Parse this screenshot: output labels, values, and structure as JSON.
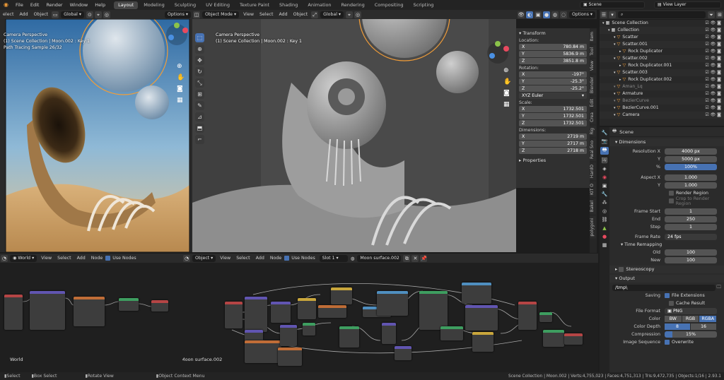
{
  "topbar": {
    "menus": [
      "File",
      "Edit",
      "Render",
      "Window",
      "Help"
    ],
    "workspaces": [
      "Layout",
      "Modeling",
      "Sculpting",
      "UV Editing",
      "Texture Paint",
      "Shading",
      "Animation",
      "Rendering",
      "Compositing",
      "Scripting"
    ],
    "active_workspace": "Layout",
    "scene": "Scene",
    "view_layer": "View Layer"
  },
  "viewport_left": {
    "header": {
      "menus": [
        "elect",
        "Add",
        "Object"
      ],
      "transform": "Global",
      "options": "Options"
    },
    "overlay": [
      "Camera Perspective",
      "(1) Scene Collection | Moon.002 : Key 1",
      "Path Tracing Sample 26/32"
    ]
  },
  "viewport_right": {
    "header": {
      "mode": "Object Mode",
      "menus": [
        "View",
        "Select",
        "Add",
        "Object"
      ],
      "transform": "Global",
      "options": "Options"
    },
    "overlay": [
      "Camera Perspective",
      "(1) Scene Collection | Moon.002 : Key 1"
    ]
  },
  "npanel": {
    "title": "Transform",
    "location_label": "Location:",
    "location": [
      {
        "axis": "X",
        "value": "780.84 m"
      },
      {
        "axis": "Y",
        "value": "5836.9 m"
      },
      {
        "axis": "Z",
        "value": "3851.8 m"
      }
    ],
    "rotation_label": "Rotation:",
    "rotation": [
      {
        "axis": "X",
        "value": "-197°"
      },
      {
        "axis": "Y",
        "value": "-25.3°"
      },
      {
        "axis": "Z",
        "value": "-25.2°"
      }
    ],
    "rotation_mode": "XYZ Euler",
    "scale_label": "Scale:",
    "scale": [
      {
        "axis": "X",
        "value": "1732.501"
      },
      {
        "axis": "Y",
        "value": "1732.501"
      },
      {
        "axis": "Z",
        "value": "1732.501"
      }
    ],
    "dimensions_label": "Dimensions:",
    "dimensions": [
      {
        "axis": "X",
        "value": "2719 m"
      },
      {
        "axis": "Y",
        "value": "2717 m"
      },
      {
        "axis": "Z",
        "value": "2718 m"
      }
    ],
    "properties": "Properties",
    "tabs": [
      "Item",
      "Tool",
      "View",
      "Blender",
      "Edit",
      "Crea",
      "Rig",
      "Real Sno",
      "HardO",
      "KIT O",
      "Bakel",
      "polygoni"
    ]
  },
  "outliner": {
    "rows": [
      {
        "label": "Scene Collection",
        "indent": 0,
        "dim": false
      },
      {
        "label": "Collection",
        "indent": 1,
        "dim": false
      },
      {
        "label": "Scatter",
        "indent": 2,
        "dim": false
      },
      {
        "label": "Scatter.001",
        "indent": 2,
        "dim": false
      },
      {
        "label": "Rock Duplicator",
        "indent": 3,
        "dim": false
      },
      {
        "label": "Scatter.002",
        "indent": 2,
        "dim": false
      },
      {
        "label": "Rock Duplicator.001",
        "indent": 3,
        "dim": false
      },
      {
        "label": "Scatter.003",
        "indent": 2,
        "dim": false
      },
      {
        "label": "Rock Duplicator.002",
        "indent": 3,
        "dim": false
      },
      {
        "label": "Aman_Lq",
        "indent": 2,
        "dim": true
      },
      {
        "label": "Armature",
        "indent": 2,
        "dim": false
      },
      {
        "label": "BezierCurve",
        "indent": 2,
        "dim": true
      },
      {
        "label": "BezierCurve.001",
        "indent": 2,
        "dim": false
      },
      {
        "label": "Camera",
        "indent": 2,
        "dim": false
      }
    ]
  },
  "properties": {
    "scene": "Scene",
    "dimensions_title": "Dimensions",
    "resolution_x_label": "Resolution X",
    "resolution_x": "4000 px",
    "resolution_y_label": "Y",
    "resolution_y": "5000 px",
    "percent_label": "%",
    "percent": "100%",
    "aspect_x_label": "Aspect X",
    "aspect_x": "1.000",
    "aspect_y_label": "Y",
    "aspect_y": "1.000",
    "render_region": "Render Region",
    "crop_region": "Crop to Render Region",
    "frame_start_label": "Frame Start",
    "frame_start": "1",
    "end_label": "End",
    "end": "250",
    "step_label": "Step",
    "step": "1",
    "frame_rate_label": "Frame Rate",
    "frame_rate": "24 fps",
    "time_remapping": "Time Remapping",
    "old_label": "Old",
    "old": "100",
    "new_label": "New",
    "new": "100",
    "stereoscopy": "Stereoscopy",
    "output_title": "Output",
    "output_path": "/tmp\\",
    "saving_label": "Saving",
    "file_extensions": "File Extensions",
    "cache_result": "Cache Result",
    "file_format_label": "File Format",
    "file_format": "PNG",
    "color_label": "Color",
    "color_options": [
      "BW",
      "RGB",
      "RGBA"
    ],
    "color_active": "RGBA",
    "color_depth_label": "Color Depth",
    "color_depth_options": [
      "8",
      "16"
    ],
    "color_depth_active": "8",
    "compression_label": "Compression",
    "compression": "15%",
    "image_sequence_label": "Image Sequence",
    "overwrite": "Overwrite"
  },
  "node_left": {
    "header": {
      "type": "World",
      "menus": [
        "View",
        "Select",
        "Add",
        "Node"
      ],
      "use_nodes": "Use Nodes"
    },
    "label": "World"
  },
  "node_right": {
    "header": {
      "type": "Object",
      "menus": [
        "View",
        "Select",
        "Add",
        "Node"
      ],
      "use_nodes": "Use Nodes",
      "slot": "Slot 1",
      "material": "Moon surface.002"
    },
    "label": "Moon surface.002"
  },
  "statusbar": {
    "select": "Select",
    "box_select": "Box Select",
    "rotate_view": "Rotate View",
    "context_menu": "Object Context Menu",
    "stats": "Scene Collection | Moon.002 | Verts:4,755,023 | Faces:4,751,313 | Tris:9,472,735 | Objects:1/16 | 2.93.1"
  },
  "colors": {
    "accent": "#4772b3",
    "selected_outline": "#f29d38",
    "bg": "#1d1d1d"
  }
}
